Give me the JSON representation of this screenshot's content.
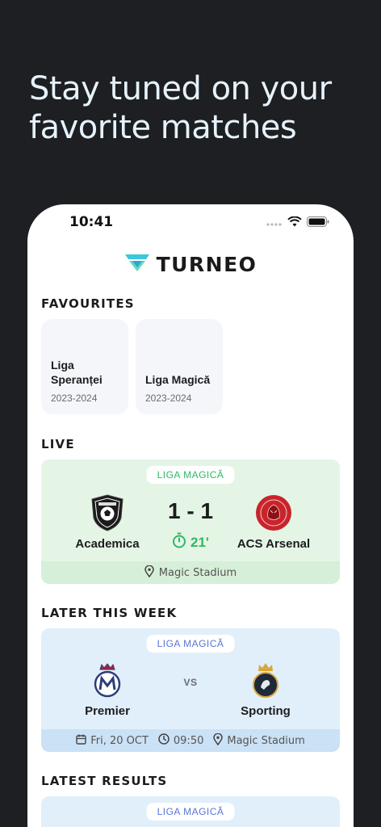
{
  "headline": "Stay tuned on your favorite matches",
  "status_bar": {
    "time": "10:41"
  },
  "brand": {
    "name": "TURNEO"
  },
  "sections": {
    "favourites": "FAVOURITES",
    "live": "LIVE",
    "later": "LATER THIS WEEK",
    "results": "LATEST RESULTS"
  },
  "favourites": [
    {
      "name": "Liga Speranței",
      "season": "2023-2024"
    },
    {
      "name": "Liga Magică",
      "season": "2023-2024"
    }
  ],
  "live_match": {
    "league": "LIGA MAGICĂ",
    "home": "Academica",
    "away": "ACS Arsenal",
    "score": "1 - 1",
    "minute": "21'",
    "stadium": "Magic Stadium"
  },
  "later_match": {
    "league": "LIGA MAGICĂ",
    "home": "Premier",
    "away": "Sporting",
    "vs": "VS",
    "date": "Fri, 20 OCT",
    "time": "09:50",
    "stadium": "Magic Stadium"
  },
  "result_match": {
    "league": "LIGA MAGICĂ"
  },
  "colors": {
    "background": "#1d1f22",
    "live_accent": "#2fb864",
    "league_blue": "#5a74d8",
    "brand_teal": "#3ec6e0"
  }
}
